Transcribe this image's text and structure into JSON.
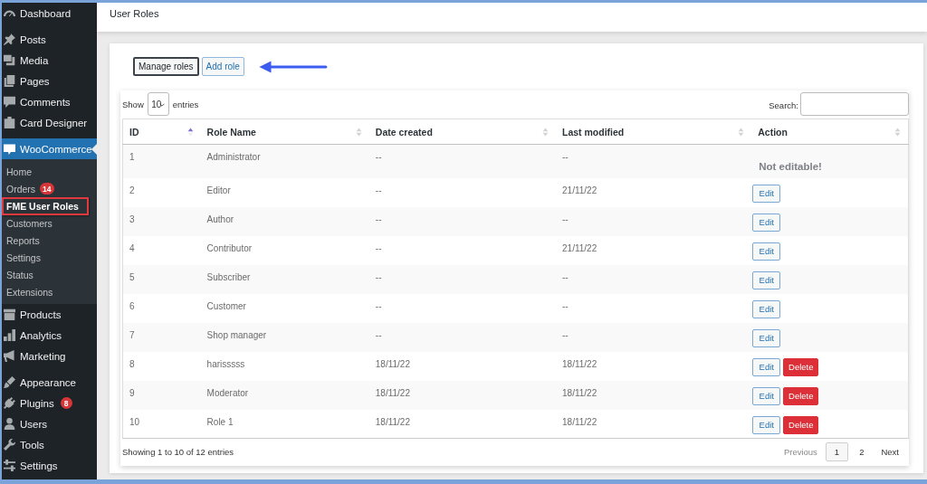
{
  "sidebar": {
    "groups": [
      {
        "items": [
          {
            "label": "Dashboard",
            "selected": false
          }
        ]
      },
      {
        "items": [
          {
            "label": "Posts",
            "selected": false
          },
          {
            "label": "Media",
            "selected": false
          },
          {
            "label": "Pages",
            "selected": false
          },
          {
            "label": "Comments",
            "selected": false
          },
          {
            "label": "Card Designer",
            "selected": false
          }
        ]
      },
      {
        "items": [
          {
            "label": "WooCommerce",
            "selected": true,
            "children": [
              {
                "label": "Home",
                "selected": false,
                "boxed": false
              },
              {
                "label": "Orders",
                "selected": false,
                "boxed": false,
                "badge": "14"
              },
              {
                "label": "FME User Roles",
                "selected": true,
                "boxed": true
              },
              {
                "label": "Customers",
                "selected": false,
                "boxed": false
              },
              {
                "label": "Reports",
                "selected": false,
                "boxed": false
              },
              {
                "label": "Settings",
                "selected": false,
                "boxed": false
              },
              {
                "label": "Status",
                "selected": false,
                "boxed": false
              },
              {
                "label": "Extensions",
                "selected": false,
                "boxed": false
              }
            ]
          },
          {
            "label": "Products",
            "selected": false
          },
          {
            "label": "Analytics",
            "selected": false
          },
          {
            "label": "Marketing",
            "selected": false
          }
        ]
      },
      {
        "items": [
          {
            "label": "Appearance",
            "selected": false
          },
          {
            "label": "Plugins",
            "selected": false,
            "badge": "8"
          },
          {
            "label": "Users",
            "selected": false
          },
          {
            "label": "Tools",
            "selected": false
          },
          {
            "label": "Settings",
            "selected": false
          }
        ]
      }
    ]
  },
  "page_header": {
    "title": "User Roles"
  },
  "buttons": [
    {
      "label": "Manage roles",
      "selected": true,
      "pointed": false
    },
    {
      "label": "Add role",
      "selected": false,
      "pointed": true
    }
  ],
  "table_controls": {
    "show_label": "Show",
    "entries_value": "10",
    "entries_label": "entries",
    "search_label": "Search:"
  },
  "table": {
    "columns": [
      {
        "label": "ID",
        "sorted": true
      },
      {
        "label": "Role Name",
        "sorted": false
      },
      {
        "label": "Date created",
        "sorted": false
      },
      {
        "label": "Last modified",
        "sorted": false
      },
      {
        "label": "Action",
        "sorted": false
      }
    ],
    "rows": [
      {
        "id": "1",
        "role_name": "Administrator",
        "date_created": "--",
        "last_modified": "--",
        "actions": [
          {
            "kind": "note",
            "label": "Not editable!"
          }
        ]
      },
      {
        "id": "2",
        "role_name": "Editor",
        "date_created": "--",
        "last_modified": "21/11/22",
        "actions": [
          {
            "kind": "edit",
            "label": "Edit"
          }
        ]
      },
      {
        "id": "3",
        "role_name": "Author",
        "date_created": "--",
        "last_modified": "--",
        "actions": [
          {
            "kind": "edit",
            "label": "Edit"
          }
        ]
      },
      {
        "id": "4",
        "role_name": "Contributor",
        "date_created": "--",
        "last_modified": "21/11/22",
        "actions": [
          {
            "kind": "edit",
            "label": "Edit"
          }
        ]
      },
      {
        "id": "5",
        "role_name": "Subscriber",
        "date_created": "--",
        "last_modified": "--",
        "actions": [
          {
            "kind": "edit",
            "label": "Edit"
          }
        ]
      },
      {
        "id": "6",
        "role_name": "Customer",
        "date_created": "--",
        "last_modified": "--",
        "actions": [
          {
            "kind": "edit",
            "label": "Edit"
          }
        ]
      },
      {
        "id": "7",
        "role_name": "Shop manager",
        "date_created": "--",
        "last_modified": "--",
        "actions": [
          {
            "kind": "edit",
            "label": "Edit"
          }
        ]
      },
      {
        "id": "8",
        "role_name": "harisssss",
        "date_created": "18/11/22",
        "last_modified": "18/11/22",
        "actions": [
          {
            "kind": "edit",
            "label": "Edit"
          },
          {
            "kind": "delete",
            "label": "Delete"
          }
        ]
      },
      {
        "id": "9",
        "role_name": "Moderator",
        "date_created": "18/11/22",
        "last_modified": "18/11/22",
        "actions": [
          {
            "kind": "edit",
            "label": "Edit"
          },
          {
            "kind": "delete",
            "label": "Delete"
          }
        ]
      },
      {
        "id": "10",
        "role_name": "Role 1",
        "date_created": "18/11/22",
        "last_modified": "18/11/22",
        "actions": [
          {
            "kind": "edit",
            "label": "Edit"
          },
          {
            "kind": "delete",
            "label": "Delete"
          }
        ]
      }
    ]
  },
  "footer": {
    "info": "Showing 1 to 10 of 12 entries",
    "pagination": [
      {
        "kind": "prev",
        "label": "Previous",
        "selected": false,
        "disabled": true
      },
      {
        "kind": "page",
        "label": "1",
        "selected": true,
        "disabled": false
      },
      {
        "kind": "page",
        "label": "2",
        "selected": false,
        "disabled": false
      },
      {
        "kind": "next",
        "label": "Next",
        "selected": false,
        "disabled": false
      }
    ]
  }
}
